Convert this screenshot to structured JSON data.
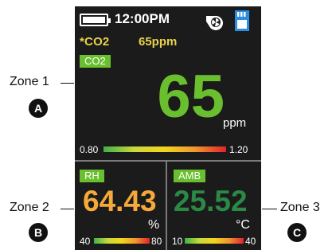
{
  "callouts": {
    "zone1": {
      "label": "Zone 1",
      "marker": "A"
    },
    "zone2": {
      "label": "Zone 2",
      "marker": "B"
    },
    "zone3": {
      "label": "Zone 3",
      "marker": "C"
    }
  },
  "status": {
    "time": "12:00PM",
    "battery_level": 1.0,
    "icons": [
      "battery-icon",
      "pump-fan-icon",
      "sd-card-icon"
    ]
  },
  "alarm": {
    "gas": "*CO2",
    "value": "65ppm"
  },
  "zone1": {
    "tag": "CO2",
    "value": "65",
    "unit": "ppm",
    "scale_min": "0.80",
    "scale_max": "1.20"
  },
  "zone2": {
    "tag": "RH",
    "value": "64.43",
    "unit": "%",
    "scale_min": "40",
    "scale_max": "80"
  },
  "zone3": {
    "tag": "AMB",
    "value": "25.52",
    "unit": "°C",
    "scale_min": "10",
    "scale_max": "40"
  },
  "colors": {
    "screen_bg": "#1b1b1b",
    "tag_green": "#6abf2f",
    "alarm_yellow": "#e8d24a",
    "rh_orange": "#f4a93a",
    "amb_green": "#2a8a45"
  }
}
